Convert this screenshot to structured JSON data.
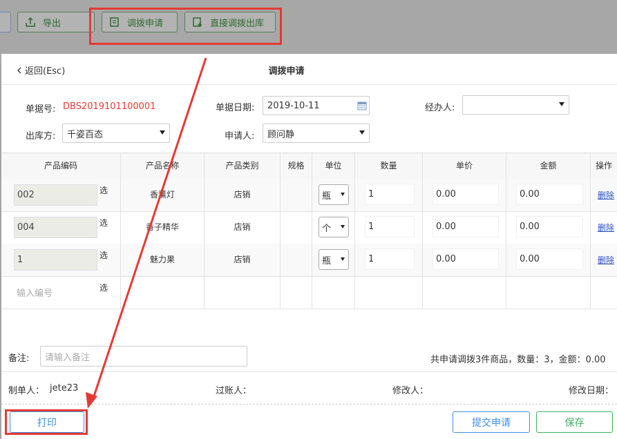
{
  "toolbar": {
    "export_label": "导出",
    "transfer_request_label": "调拨申请",
    "direct_transfer_label": "直接调拨出库"
  },
  "modal": {
    "back_label": "返回(Esc)",
    "title": "调拨申请"
  },
  "form": {
    "doc_no_label": "单据号:",
    "doc_no_value": "DBS2019101100001",
    "doc_date_label": "单据日期:",
    "doc_date_value": "2019-10-11",
    "handler_label": "经办人:",
    "handler_value": "",
    "outbound_label": "出库方:",
    "outbound_value": "千姿百态",
    "applicant_label": "申请人:",
    "applicant_value": "顾问静"
  },
  "table": {
    "headers": [
      "产品编码",
      "产品名称",
      "产品类别",
      "规格",
      "单位",
      "数量",
      "单价",
      "金额",
      "操作"
    ],
    "select_label": "选",
    "delete_label": "删除",
    "rows": [
      {
        "code": "002",
        "name": "香薰灯",
        "category": "店销",
        "spec": "",
        "unit": "瓶",
        "qty": "1",
        "price": "0.00",
        "amount": "0.00"
      },
      {
        "code": "004",
        "name": "香子精华",
        "category": "店销",
        "spec": "",
        "unit": "个",
        "qty": "1",
        "price": "0.00",
        "amount": "0.00"
      },
      {
        "code": "1",
        "name": "魅力果",
        "category": "店销",
        "spec": "",
        "unit": "瓶",
        "qty": "1",
        "price": "0.00",
        "amount": "0.00"
      }
    ],
    "new_row_placeholder": "输入编号"
  },
  "notes": {
    "label": "备注:",
    "placeholder": "请输入备注",
    "summary": "共申请调拨3件商品，数量：3，金额：0.00"
  },
  "meta": {
    "maker_label": "制单人：",
    "maker_value": "jete23",
    "poster_label": "过账人：",
    "modifier_label": "修改人：",
    "modified_date_label": "修改日期："
  },
  "buttons": {
    "print_label": "打印",
    "submit_label": "提交申请",
    "save_label": "保存"
  },
  "colors": {
    "highlight": "#e53935",
    "link": "#2a52be",
    "primary_blue": "#3a8ee6",
    "primary_green": "#3cb35d"
  }
}
